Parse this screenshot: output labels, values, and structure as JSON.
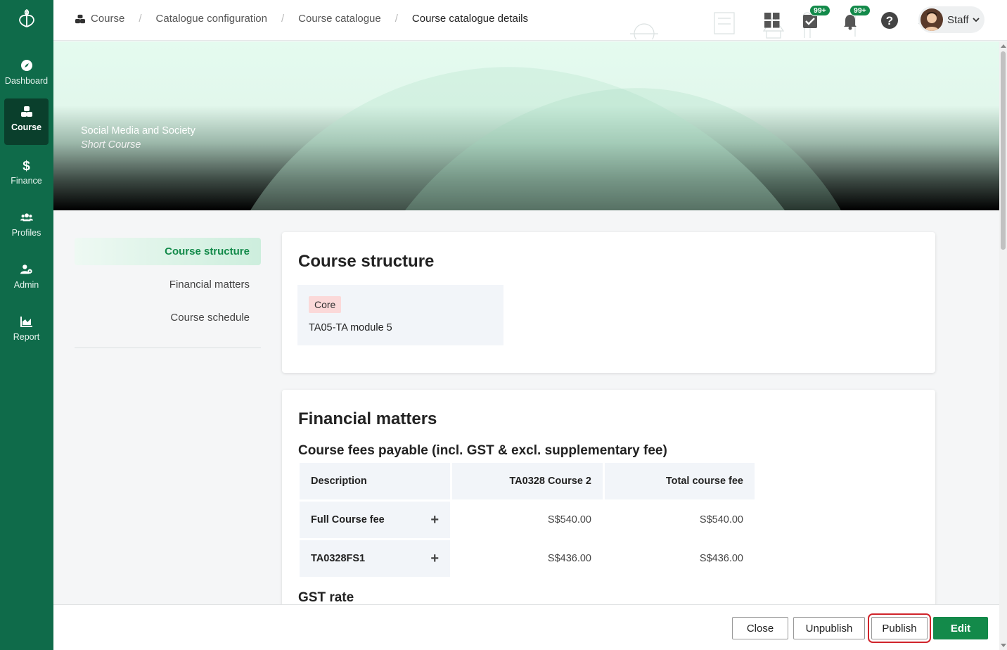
{
  "sidebar": {
    "logo_icon": "leaf-book-logo",
    "items": [
      {
        "label": "Dashboard",
        "icon": "compass-icon",
        "active": false
      },
      {
        "label": "Course",
        "icon": "course-cubes-icon",
        "active": true
      },
      {
        "label": "Finance",
        "icon": "dollar-icon",
        "active": false
      },
      {
        "label": "Profiles",
        "icon": "users-icon",
        "active": false
      },
      {
        "label": "Admin",
        "icon": "user-gear-icon",
        "active": false
      },
      {
        "label": "Report",
        "icon": "area-chart-icon",
        "active": false
      }
    ]
  },
  "breadcrumb": {
    "items": [
      "Course",
      "Catalogue configuration",
      "Course catalogue",
      "Course catalogue details"
    ]
  },
  "header": {
    "tasks_badge": "99+",
    "notifications_badge": "99+",
    "user_name": "Staff"
  },
  "banner": {
    "title": "Social Media and Society",
    "subtitle": "Short Course"
  },
  "section_nav": {
    "items": [
      "Course structure",
      "Financial matters",
      "Course schedule"
    ]
  },
  "course_structure": {
    "title": "Course structure",
    "tag": "Core",
    "module": "TA05-TA module 5"
  },
  "financial_matters": {
    "title": "Financial matters",
    "fees_title": "Course fees payable (incl. GST & excl. supplementary fee)",
    "headers": [
      "Description",
      "TA0328 Course 2",
      "Total course fee"
    ],
    "rows": [
      {
        "description": "Full Course fee",
        "course2": "S$540.00",
        "total": "S$540.00"
      },
      {
        "description": "TA0328FS1",
        "course2": "S$436.00",
        "total": "S$436.00"
      }
    ],
    "gst_title": "GST rate"
  },
  "footer": {
    "close_label": "Close",
    "unpublish_label": "Unpublish",
    "publish_label": "Publish",
    "edit_label": "Edit"
  },
  "colors": {
    "sidebar_bg": "#0f6b4a",
    "sidebar_active": "#0a3f2c",
    "accent": "#138a4a",
    "highlight_outline": "#d0242b"
  }
}
